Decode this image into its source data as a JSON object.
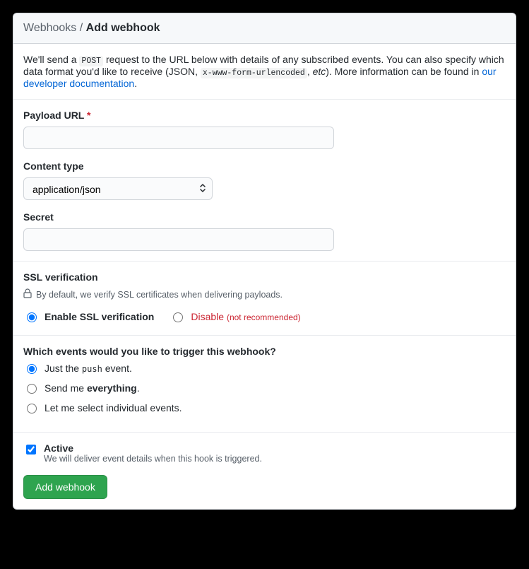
{
  "header": {
    "crumb": "Webhooks / ",
    "title": "Add webhook"
  },
  "intro": {
    "t1": "We'll send a ",
    "code1": "POST",
    "t2": " request to the URL below with details of any subscribed events. You can also specify which data format you'd like to receive (JSON, ",
    "code2": "x-www-form-urlencoded",
    "t3": ", ",
    "em": "etc",
    "t4": "). More information can be found in ",
    "link": "our developer documentation",
    "t5": "."
  },
  "fields": {
    "payload_label": "Payload URL",
    "required_mark": "*",
    "content_type_label": "Content type",
    "content_type_value": "application/json",
    "secret_label": "Secret"
  },
  "ssl": {
    "heading": "SSL verification",
    "note": "By default, we verify SSL certificates when delivering payloads.",
    "enable": "Enable SSL verification",
    "disable": "Disable",
    "disable_warn": "(not recommended)"
  },
  "events": {
    "heading": "Which events would you like to trigger this webhook?",
    "opt1a": "Just the ",
    "opt1code": "push",
    "opt1b": " event.",
    "opt2a": "Send me ",
    "opt2strong": "everything",
    "opt2b": ".",
    "opt3": "Let me select individual events."
  },
  "active": {
    "label": "Active",
    "desc": "We will deliver event details when this hook is triggered."
  },
  "submit": "Add webhook"
}
